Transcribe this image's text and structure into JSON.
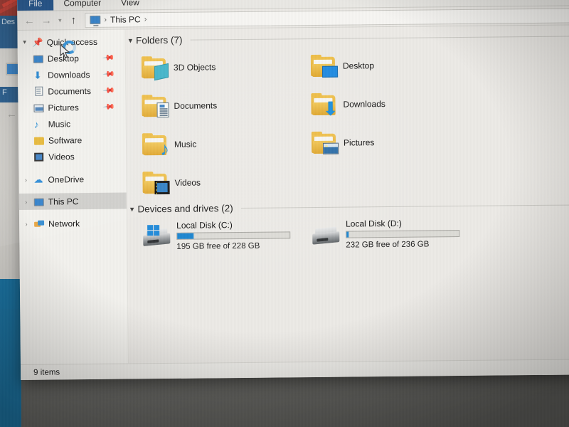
{
  "window": {
    "title": "This PC",
    "ribbon_tabs": [
      {
        "label": "File",
        "icon": "file-tab"
      },
      {
        "label": "Computer",
        "icon": "computer-tab"
      },
      {
        "label": "View",
        "icon": "view-tab"
      }
    ],
    "nav": {
      "back_icon": "back-arrow-icon",
      "forward_icon": "forward-arrow-icon",
      "recent_icon": "chevron-down-icon",
      "up_icon": "up-arrow-icon"
    },
    "address": {
      "root_icon": "this-pc-icon",
      "sep1": "›",
      "crumb": "This PC",
      "sep2": "›"
    },
    "status": {
      "items_text": "9 items"
    }
  },
  "sidebar": {
    "items": [
      {
        "label": "Quick access",
        "icon": "star-pin-icon",
        "chev": "⌄",
        "expanded": true,
        "indent": false,
        "pinned": false,
        "selected": false
      },
      {
        "label": "Desktop",
        "icon": "monitor-icon",
        "chev": "",
        "indent": true,
        "pinned": true,
        "selected": false
      },
      {
        "label": "Downloads",
        "icon": "download-arrow-icon",
        "chev": "",
        "indent": true,
        "pinned": true,
        "selected": false
      },
      {
        "label": "Documents",
        "icon": "document-icon",
        "chev": "",
        "indent": true,
        "pinned": true,
        "selected": false
      },
      {
        "label": "Pictures",
        "icon": "picture-icon",
        "chev": "",
        "indent": true,
        "pinned": true,
        "selected": false
      },
      {
        "label": "Music",
        "icon": "music-note-icon",
        "chev": "",
        "indent": true,
        "pinned": false,
        "selected": false
      },
      {
        "label": "Software",
        "icon": "folder-icon",
        "chev": "",
        "indent": true,
        "pinned": false,
        "selected": false
      },
      {
        "label": "Videos",
        "icon": "video-icon",
        "chev": "",
        "indent": true,
        "pinned": false,
        "selected": false
      },
      {
        "label": "OneDrive",
        "icon": "cloud-icon",
        "chev": "›",
        "indent": false,
        "pinned": false,
        "selected": false
      },
      {
        "label": "This PC",
        "icon": "this-pc-icon",
        "chev": "›",
        "indent": false,
        "pinned": false,
        "selected": true
      },
      {
        "label": "Network",
        "icon": "network-icon",
        "chev": "›",
        "indent": false,
        "pinned": false,
        "selected": false
      }
    ]
  },
  "content": {
    "groups": [
      {
        "title": "Folders (7)",
        "chevron": "⌄",
        "items": [
          {
            "label": "3D Objects",
            "icon": "folder-3d-objects-icon",
            "emblem": "cube"
          },
          {
            "label": "Desktop",
            "icon": "folder-desktop-icon",
            "emblem": "desk"
          },
          {
            "label": "Documents",
            "icon": "folder-documents-icon",
            "emblem": "docs"
          },
          {
            "label": "Downloads",
            "icon": "folder-downloads-icon",
            "emblem": "arrow"
          },
          {
            "label": "Music",
            "icon": "folder-music-icon",
            "emblem": "music"
          },
          {
            "label": "Pictures",
            "icon": "folder-pictures-icon",
            "emblem": "pics"
          },
          {
            "label": "Videos",
            "icon": "folder-videos-icon",
            "emblem": "film"
          }
        ]
      },
      {
        "title": "Devices and drives (2)",
        "chevron": "⌄",
        "drives": [
          {
            "name": "Local Disk (C:)",
            "icon": "hard-drive-windows-icon",
            "free_text": "195 GB free of 228 GB",
            "free_gb": 195,
            "total_gb": 228,
            "used_percent": 14.5,
            "bar_color": "#1a84cf"
          },
          {
            "name": "Local Disk (D:)",
            "icon": "hard-drive-icon",
            "free_text": "232 GB free of 236 GB",
            "free_gb": 232,
            "total_gb": 236,
            "used_percent": 2,
            "bar_color": "#1a84cf"
          }
        ]
      }
    ]
  },
  "background": {
    "window_label_1": "Des",
    "window_label_2": "F"
  },
  "colors": {
    "accent": "#1a84cf",
    "file_tab": "#1a4f8a",
    "folder_yellow": "#e6b735",
    "selection": "#cfcecb",
    "window_bg": "#eceae6"
  }
}
